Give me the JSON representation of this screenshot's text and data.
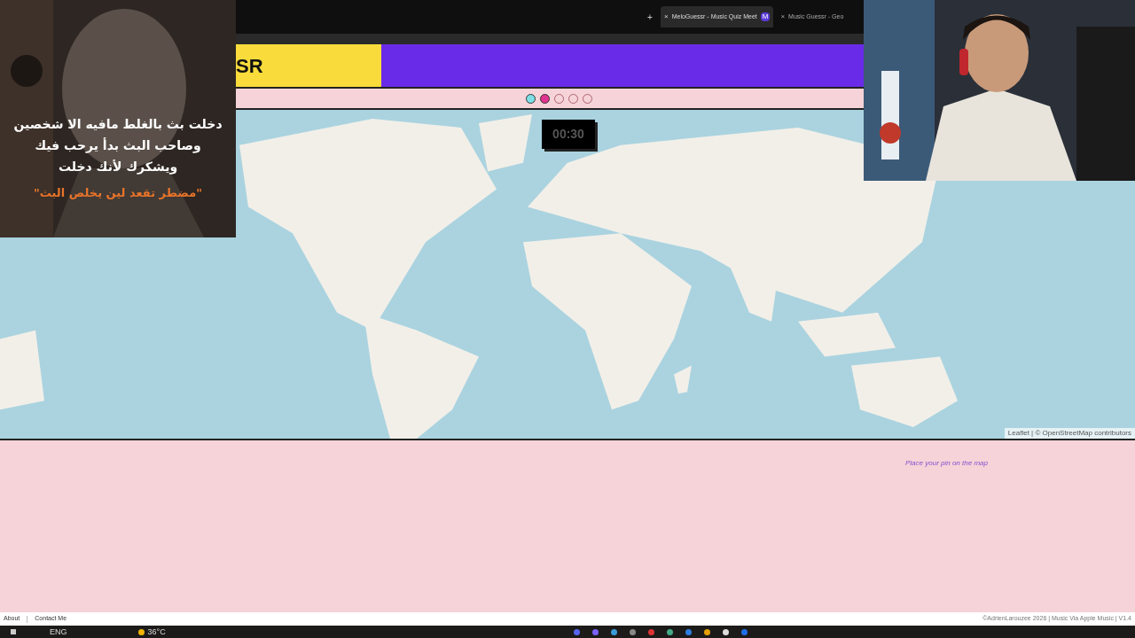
{
  "browser": {
    "tabs": [
      {
        "close": "×",
        "title": "MeloGuessr - Music Quiz Meet",
        "favicon": "M",
        "selected": true
      },
      {
        "close": "×",
        "title": "Music Guessr - Geo",
        "selected": false
      }
    ],
    "new_tab": "+"
  },
  "header": {
    "logo": "SR"
  },
  "rounds": [
    {
      "kind": "done"
    },
    {
      "kind": "current"
    },
    {
      "kind": "pending"
    },
    {
      "kind": "pending"
    },
    {
      "kind": "pending"
    }
  ],
  "map": {
    "kind": "picture",
    "timer": "00:30",
    "attribution": "Leaflet | © OpenStreetMap contributors"
  },
  "hint": "Place your pin on the map",
  "footer": {
    "links": [
      "About",
      "Contact Me"
    ],
    "credit": "©AdrienLarouzee 2026 | Music Via Apple Music | V1.4"
  },
  "taskbar": {
    "language": "ENG",
    "weather": "36°C"
  },
  "overlay": {
    "kind": "picture",
    "lines": [
      "دخلت بث بالغلط مافيه الا شخصين",
      "وصاحب البث بدأ يرحب فيك",
      "ويشكرك لأنك دخلت"
    ],
    "quote": "\"مضطر تقعد لين يخلص البث\""
  }
}
